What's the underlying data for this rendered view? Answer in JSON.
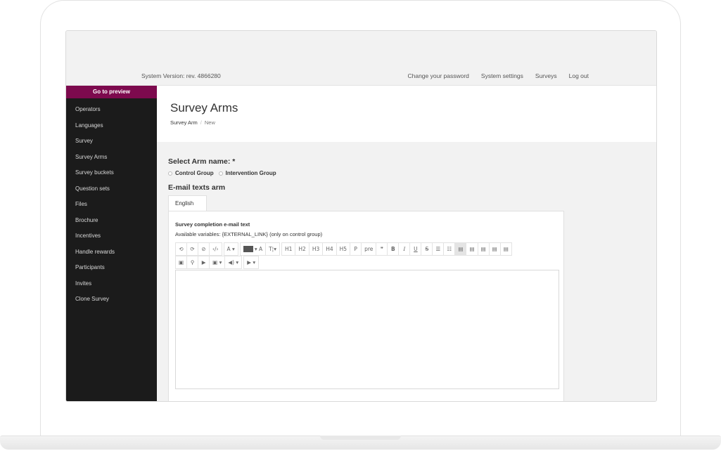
{
  "header": {
    "system_version": "System Version: rev. 4866280",
    "nav": [
      "Change your password",
      "System settings",
      "Surveys",
      "Log out"
    ]
  },
  "sidebar": {
    "preview_button": "Go to preview",
    "items": [
      "Operators",
      "Languages",
      "Survey",
      "Survey Arms",
      "Survey buckets",
      "Question sets",
      "Files",
      "Brochure",
      "Incentives",
      "Handle rewards",
      "Participants",
      "Invites",
      "Clone Survey"
    ]
  },
  "page": {
    "title": "Survey Arms",
    "breadcrumb": {
      "parent": "Survey Arm",
      "separator": "/",
      "current": "New"
    }
  },
  "form": {
    "arm_label": "Select Arm name: *",
    "arm_options": [
      "Control Group",
      "Intervention Group"
    ],
    "email_heading": "E-mail texts arm",
    "tab": "English",
    "field_label": "Survey completion e-mail text",
    "variables_text": "Available variables: {EXTERNAL_LINK} (only on control group)"
  },
  "toolbar": {
    "row1": [
      "⟲",
      "⟳",
      "⊘",
      "‹/›",
      "A ▾",
      "▾ A",
      "T¦▾",
      "H1",
      "H2",
      "H3",
      "H4",
      "H5",
      "P",
      "pre",
      "❞",
      "B",
      "I",
      "U",
      "S",
      "☰",
      "☷",
      "▤",
      "▤",
      "▤",
      "▤",
      "▤"
    ],
    "row2": [
      "▣",
      "⚲",
      "▶",
      "▣ ▾",
      "◀) ▾",
      "▶ ▾"
    ]
  },
  "colors": {
    "sidebar_bg": "#1b1b1b",
    "accent": "#7d0a4e",
    "text_color_swatch": "#555555"
  }
}
